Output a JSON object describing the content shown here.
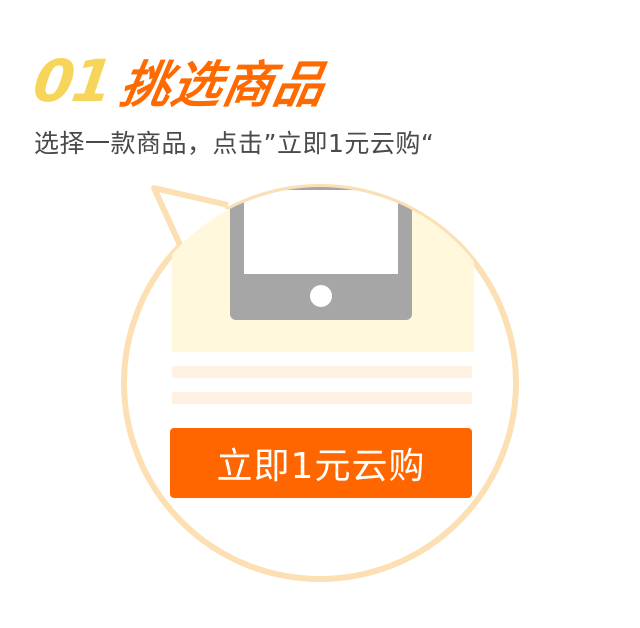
{
  "header": {
    "step_number": "01",
    "step_title": "挑选商品",
    "description": "选择一款商品，点击”立即1元云购“"
  },
  "illustration": {
    "device_icon": "mobile-phone-icon",
    "button_label": "立即1元云购"
  },
  "colors": {
    "accent_orange": "#ff6600",
    "number_yellow": "#f7d55a",
    "bubble_border": "#fce0b4",
    "panel_fill": "#fff8dc",
    "device_gray": "#a6a6a6"
  }
}
